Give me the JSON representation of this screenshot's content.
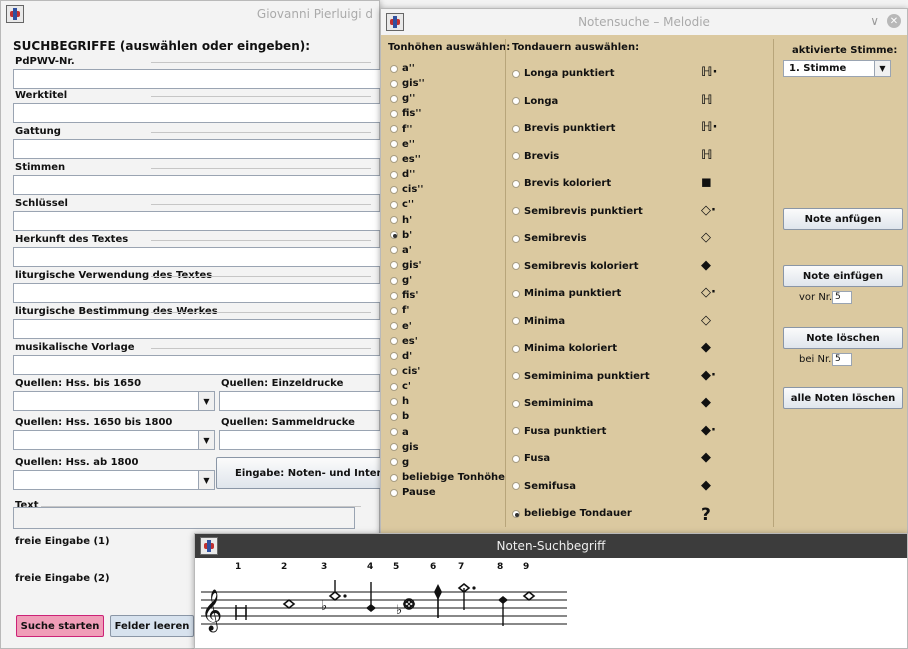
{
  "main_window": {
    "title": "Giovanni Pierluigi d",
    "heading": "SUCHBEGRIFFE (auswählen oder eingeben):",
    "fields": [
      {
        "label": "PdPWV-Nr.",
        "value": ""
      },
      {
        "label": "Werktitel",
        "value": ""
      },
      {
        "label": "Gattung",
        "value": ""
      },
      {
        "label": "Stimmen",
        "value": ""
      },
      {
        "label": "Schlüssel",
        "value": ""
      },
      {
        "label": "Herkunft des Textes",
        "value": ""
      },
      {
        "label": "liturgische Verwendung des Textes",
        "value": ""
      },
      {
        "label": "liturgische Bestimmung des Werkes",
        "value": ""
      },
      {
        "label": "musikalische Vorlage",
        "value": ""
      }
    ],
    "sources": {
      "hss_bis_1650": "Quellen: Hss. bis 1650",
      "einzeldrucke": "Quellen: Einzeldrucke",
      "hss_1650_1800": "Quellen: Hss. 1650 bis 1800",
      "sammeldrucke": "Quellen: Sammeldrucke",
      "hss_ab_1800": "Quellen: Hss. ab 1800"
    },
    "entry_button": "Eingabe: Noten- und Intervalls",
    "text_label": "Text",
    "free1_label": "freie Eingabe (1)",
    "free2_label": "freie Eingabe (2)",
    "search_button": "Suche starten",
    "clear_button": "Felder leeren"
  },
  "melody_window": {
    "title": "Notensuche – Melodie",
    "pitch_heading": "Tonhöhen auswählen:",
    "pitches": [
      "a''",
      "gis''",
      "g''",
      "fis''",
      "f''",
      "e''",
      "es''",
      "d''",
      "cis''",
      "c''",
      "h'",
      "b'",
      "a'",
      "gis'",
      "g'",
      "fis'",
      "f'",
      "e'",
      "es'",
      "d'",
      "cis'",
      "c'",
      "h",
      "b",
      "a",
      "gis",
      "g",
      "beliebige Tonhöhe",
      "Pause"
    ],
    "pitch_selected": "b'",
    "duration_heading": "Tondauern auswählen:",
    "durations": [
      {
        "label": "Longa punktiert",
        "icon": "longa-dotted-icon"
      },
      {
        "label": "Longa",
        "icon": "longa-icon"
      },
      {
        "label": "Brevis punktiert",
        "icon": "brevis-dotted-icon"
      },
      {
        "label": "Brevis",
        "icon": "brevis-icon"
      },
      {
        "label": "Brevis koloriert",
        "icon": "brevis-colored-icon"
      },
      {
        "label": "Semibrevis punktiert",
        "icon": "semibrevis-dotted-icon"
      },
      {
        "label": "Semibrevis",
        "icon": "semibrevis-icon"
      },
      {
        "label": "Semibrevis koloriert",
        "icon": "semibrevis-colored-icon"
      },
      {
        "label": "Minima punktiert",
        "icon": "minima-dotted-icon"
      },
      {
        "label": "Minima",
        "icon": "minima-icon"
      },
      {
        "label": "Minima koloriert",
        "icon": "minima-colored-icon"
      },
      {
        "label": "Semiminima punktiert",
        "icon": "semiminima-dotted-icon"
      },
      {
        "label": "Semiminima",
        "icon": "semiminima-icon"
      },
      {
        "label": "Fusa punktiert",
        "icon": "fusa-dotted-icon"
      },
      {
        "label": "Fusa",
        "icon": "fusa-icon"
      },
      {
        "label": "Semifusa",
        "icon": "semifusa-icon"
      },
      {
        "label": "beliebige Tondauer",
        "icon": "question-mark-icon"
      }
    ],
    "duration_selected": "beliebige Tondauer",
    "any_duration_glyph": "?",
    "voice_label": "aktivierte Stimme:",
    "voice_value": "1. Stimme",
    "append_button": "Note anfügen",
    "insert_button": "Note einfügen",
    "insert_before_label": "vor Nr.:",
    "insert_before_value": "5",
    "delete_button": "Note löschen",
    "delete_at_label": "bei Nr.:",
    "delete_at_value": "5",
    "delete_all_button": "alle Noten löschen"
  },
  "search_term_window": {
    "title": "Noten-Suchbegriff",
    "note_numbers": [
      "1",
      "2",
      "3",
      "4",
      "5",
      "6",
      "7",
      "8",
      "9"
    ]
  },
  "colors": {
    "panel_tan": "#dbc9a0",
    "main_bg": "#f3f3f3",
    "search_button_pink": "#f09db8"
  }
}
